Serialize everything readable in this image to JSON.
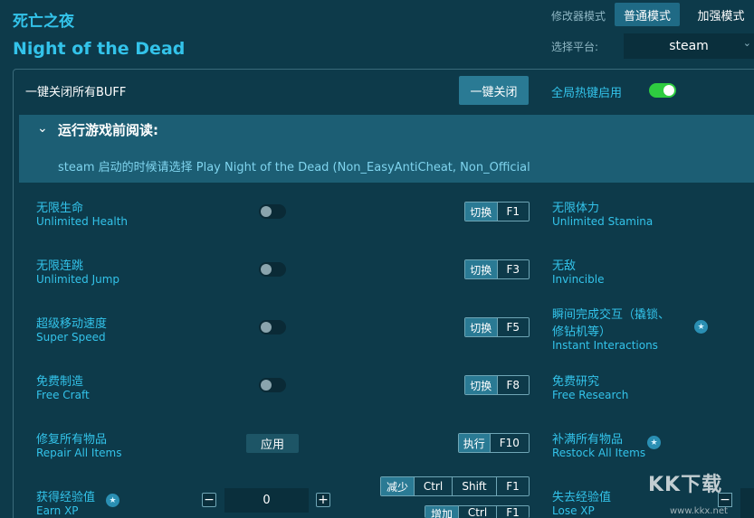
{
  "header": {
    "title_cn": "死亡之夜",
    "title_en": "Night of the Dead",
    "mode_label": "修改器模式",
    "mode_normal": "普通模式",
    "mode_enhanced": "加强模式",
    "platform_label": "选择平台:",
    "platform_value": "steam"
  },
  "global": {
    "buff_label": "一键关闭所有BUFF",
    "buff_button": "一键关闭",
    "hotkey_label": "全局热键启用",
    "hotkey_enabled": true
  },
  "notice": {
    "heading": "运行游戏前阅读:",
    "text": "steam 启动的时候请选择 Play Night of the Dead (Non_EasyAntiCheat, Non_Official"
  },
  "options_left": [
    {
      "cn": "无限生命",
      "en": "Unlimited Health",
      "action": "切换",
      "key": "F1"
    },
    {
      "cn": "无限连跳",
      "en": "Unlimited Jump",
      "action": "切换",
      "key": "F3"
    },
    {
      "cn": "超级移动速度",
      "en": "Super Speed",
      "action": "切换",
      "key": "F5"
    },
    {
      "cn": "免费制造",
      "en": "Free Craft",
      "action": "切换",
      "key": "F8"
    },
    {
      "cn": "修复所有物品",
      "en": "Repair All Items",
      "apply": "应用",
      "action": "执行",
      "key": "F10"
    },
    {
      "cn": "获得经验值",
      "en": "Earn XP",
      "value": "0",
      "minus": "−",
      "plus": "+",
      "dec_action": "减少",
      "inc_action": "增加",
      "k1": "Ctrl",
      "k2": "Shift",
      "k3": "F1"
    }
  ],
  "options_right": [
    {
      "cn": "无限体力",
      "en": "Unlimited Stamina"
    },
    {
      "cn": "无敌",
      "en": "Invincible"
    },
    {
      "cn": "瞬间完成交互（撬锁、",
      "cn2": "修钻机等）",
      "en": "Instant Interactions"
    },
    {
      "cn": "免费研究",
      "en": "Free Research"
    },
    {
      "cn": "补满所有物品",
      "en": "Restock All Items"
    },
    {
      "cn": "失去经验值",
      "en": "Lose XP",
      "minus": "−"
    }
  ],
  "icons": {
    "star": "star-icon",
    "chevron": "chevron-down-icon"
  },
  "watermark": {
    "main": "KK下载",
    "sub": "www.kkx.net"
  },
  "colors": {
    "accent": "#33c3ea",
    "bg": "#0d3a4a",
    "toggle_on": "#2ecc40"
  }
}
